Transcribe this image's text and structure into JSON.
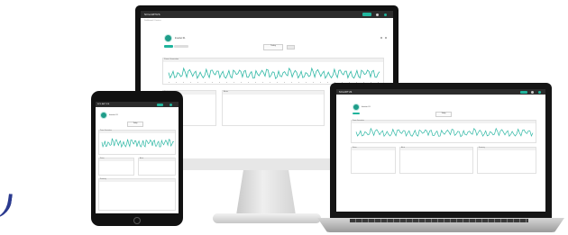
{
  "app": {
    "brand": "SOLARTUS",
    "breadcrumb": "Dashboard / Devices",
    "device_name": "Inverter 01",
    "date_select": "Today",
    "sections": {
      "power_chart": "Power Generation",
      "panel_a": "Status",
      "panel_b": "Alerts",
      "panel_c": "Summary"
    }
  },
  "colors": {
    "accent": "#20b49c",
    "topbar": "#2c2c2c",
    "line": "#2fb8a5"
  },
  "icons": [
    "user-icon",
    "settings-icon",
    "bell-icon",
    "home-button-icon"
  ]
}
